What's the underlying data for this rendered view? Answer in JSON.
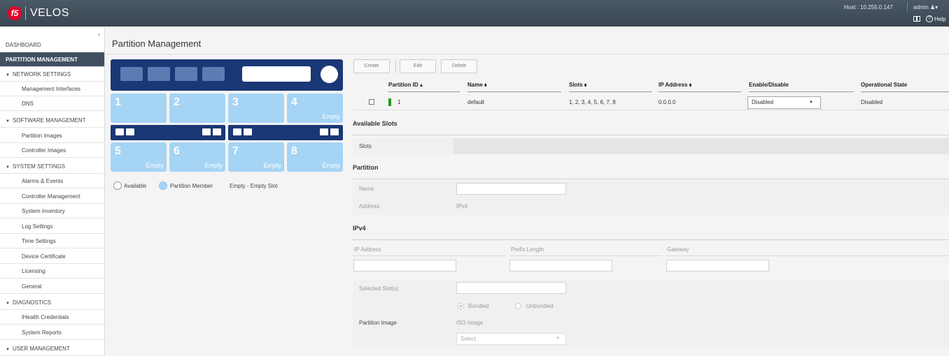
{
  "app": {
    "logo_text": "f5",
    "name": "VELOS",
    "host": "Host : 10.255.0.147",
    "user": "admin ♟▾",
    "help": "Help"
  },
  "sidebar": {
    "collapse": "‹",
    "items": [
      {
        "label": "DASHBOARD"
      },
      {
        "label": "PARTITION MANAGEMENT"
      },
      {
        "label": "NETWORK SETTINGS"
      },
      {
        "label": "Management Interfaces"
      },
      {
        "label": "DNS"
      },
      {
        "label": "SOFTWARE MANAGEMENT"
      },
      {
        "label": "Partition Images"
      },
      {
        "label": "Controller Images"
      },
      {
        "label": "SYSTEM SETTINGS"
      },
      {
        "label": "Alarms & Events"
      },
      {
        "label": "Controller Management"
      },
      {
        "label": "System Inventory"
      },
      {
        "label": "Log Settings"
      },
      {
        "label": "Time Settings"
      },
      {
        "label": "Device Certificate"
      },
      {
        "label": "Licensing"
      },
      {
        "label": "General"
      },
      {
        "label": "DIAGNOSTICS"
      },
      {
        "label": "iHealth Credentials"
      },
      {
        "label": "System Reports"
      },
      {
        "label": "USER MANAGEMENT"
      }
    ]
  },
  "page": {
    "title": "Partition Management"
  },
  "chassis": {
    "slots": [
      {
        "num": "1",
        "status": ""
      },
      {
        "num": "2",
        "status": ""
      },
      {
        "num": "3",
        "status": ""
      },
      {
        "num": "4",
        "status": "Empty"
      },
      {
        "num": "5",
        "status": "Empty"
      },
      {
        "num": "6",
        "status": "Empty"
      },
      {
        "num": "7",
        "status": "Empty"
      },
      {
        "num": "8",
        "status": "Empty"
      }
    ],
    "legend": {
      "available": "Available",
      "member": "Partition Member",
      "empty": "Empty - Empty Slot"
    },
    "colors": {
      "frame": "#1a3876",
      "slot": "#a6d4f4"
    }
  },
  "toolbar": {
    "create": "Create",
    "edit": "Edit",
    "delete": "Delete"
  },
  "table": {
    "headers": [
      "Partition ID ▴",
      "Name ⬧",
      "Slots ⬧",
      "IP Address ⬧",
      "Enable/Disable",
      "Operational State"
    ],
    "rows": [
      {
        "id": "1",
        "name": "default",
        "slots": "1, 2, 3, 4, 5, 6, 7, 8",
        "ip": "0.0.0.0",
        "enable": "Disabled",
        "state": "Disabled"
      }
    ]
  },
  "available_slots": {
    "title": "Available Slots",
    "slots_label": "Slots"
  },
  "partition": {
    "title": "Partition",
    "name_label": "Name",
    "address_label": "Address",
    "address_value": "IPv4"
  },
  "ipv4": {
    "title": "IPv4",
    "ip_label": "IP Address",
    "prefix_label": "Prefix Length",
    "gateway_label": "Gateway",
    "selected_slots_label": "Selected Slot(s)",
    "image_label": "Partition Image",
    "bundled": "Bundled",
    "unbundled": "Unbundled",
    "iso_label": "ISO Image",
    "select_placeholder": "Select"
  }
}
